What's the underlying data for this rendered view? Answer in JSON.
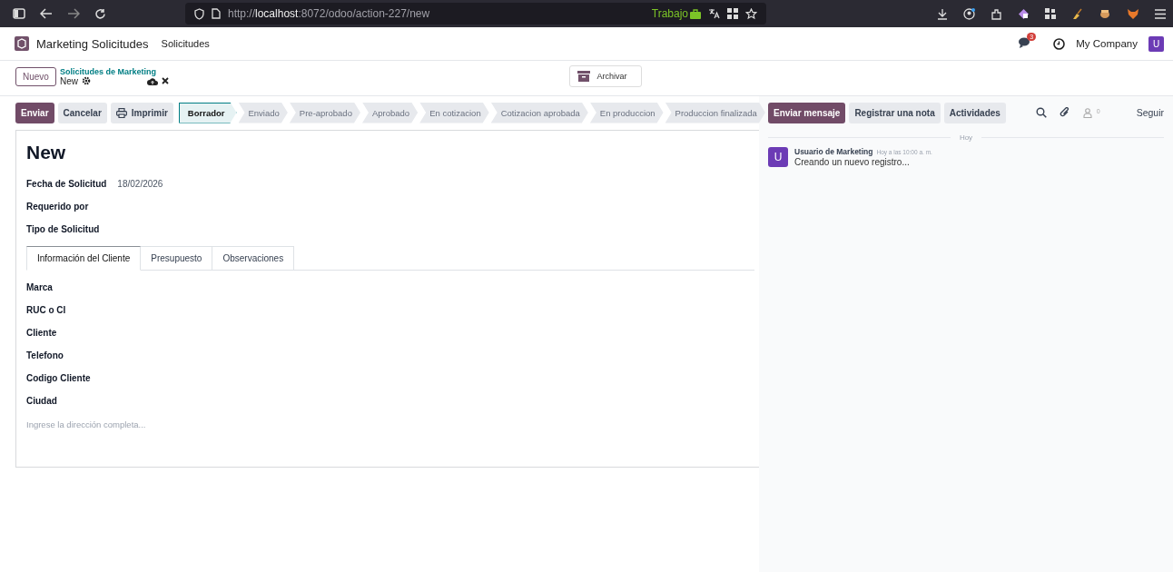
{
  "browser": {
    "url": "http://**localhost**:8072/odoo/action-227/new",
    "container_label": "Trabajo"
  },
  "navbar": {
    "app_name": "Marketing Solicitudes",
    "menu": [
      "Solicitudes"
    ],
    "message_count": "3",
    "company": "My Company",
    "avatar": "U"
  },
  "control_panel": {
    "new_button": "Nuevo",
    "breadcrumb": "Solicitudes de Marketing",
    "record": "New",
    "archive_button": "Archivar"
  },
  "actions": [
    {
      "label": "Enviar",
      "kind": "primary"
    },
    {
      "label": "Cancelar",
      "kind": "secondary"
    },
    {
      "label": "Imprimir",
      "kind": "print"
    }
  ],
  "stages": [
    {
      "label": "Borrador",
      "selected": true
    },
    {
      "label": "Enviado",
      "selected": false
    },
    {
      "label": "Pre-aprobado",
      "selected": false
    },
    {
      "label": "Aprobado",
      "selected": false
    },
    {
      "label": "En cotizacion",
      "selected": false
    },
    {
      "label": "Cotizacion aprobada",
      "selected": false
    },
    {
      "label": "En produccion",
      "selected": false
    },
    {
      "label": "Produccion finalizada",
      "selected": false
    }
  ],
  "form": {
    "title": "New",
    "fields": [
      {
        "label": "Fecha de Solicitud",
        "value": "18/02/2026"
      },
      {
        "label": "Requerido por"
      },
      {
        "label": "Tipo de Solicitud"
      }
    ],
    "tabs": [
      {
        "label": "Información del Cliente",
        "selected": true
      },
      {
        "label": "Presupuesto",
        "selected": false
      },
      {
        "label": "Observaciones",
        "selected": false
      }
    ],
    "tab_fields": [
      "Marca",
      "RUC o CI",
      "Cliente",
      "Telefono",
      "Codigo Cliente",
      "Ciudad"
    ],
    "address_placeholder": "Ingrese la dirección completa..."
  },
  "chatter": {
    "buttons": [
      {
        "label": "Enviar mensaje",
        "kind": "primary"
      },
      {
        "label": "Registrar una nota",
        "kind": "secondary"
      },
      {
        "label": "Actividades",
        "kind": "secondary"
      }
    ],
    "follower_count": "0",
    "follow": "Seguir",
    "date_separator": "Hoy",
    "messages": [
      {
        "avatar": "U",
        "author": "Usuario de Marketing",
        "time": "Hoy a las 10:00 a. m.",
        "body": "Creando un nuevo registro..."
      }
    ]
  }
}
